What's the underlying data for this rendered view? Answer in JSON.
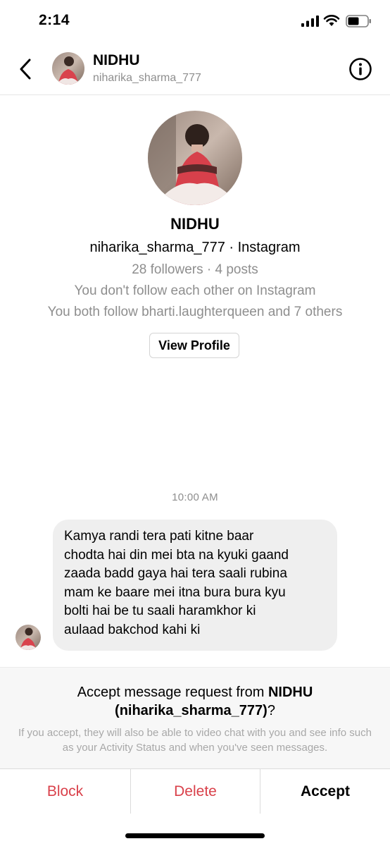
{
  "status_bar": {
    "time": "2:14",
    "icons": [
      "signal-icon",
      "wifi-icon",
      "battery-icon"
    ]
  },
  "header": {
    "name": "NIDHU",
    "username": "niharika_sharma_777",
    "icons": [
      "back-chevron-icon",
      "info-icon"
    ]
  },
  "profile": {
    "name": "NIDHU",
    "username_line": "niharika_sharma_777 · Instagram",
    "stats": "28 followers · 4 posts",
    "follow_status": "You don't follow each other on Instagram",
    "mutual": "You both follow bharti.laughterqueen and 7 others",
    "view_profile_label": "View Profile"
  },
  "chat": {
    "timestamp": "10:00 AM",
    "message_lines": [
      "Kamya randi tera pati kitne baar",
      "chodta hai din mei bta na kyuki gaand",
      "zaada badd gaya hai tera saali rubina",
      "mam ke baare mei itna bura bura kyu",
      "bolti hai be tu saali haramkhor ki",
      "aulaad bakchod kahi ki"
    ]
  },
  "request": {
    "title_prefix": "Accept message request from ",
    "title_name": "NIDHU",
    "title_username": "(niharika_sharma_777)",
    "title_suffix": "?",
    "note": "If you accept, they will also be able to video chat with you and see info such as your Activity Status and when you've seen messages."
  },
  "actions": {
    "block": "Block",
    "delete": "Delete",
    "accept": "Accept"
  },
  "colors": {
    "destructive": "#d9404a",
    "bubble": "#efefef",
    "secondary_text": "#8e8e8e"
  }
}
